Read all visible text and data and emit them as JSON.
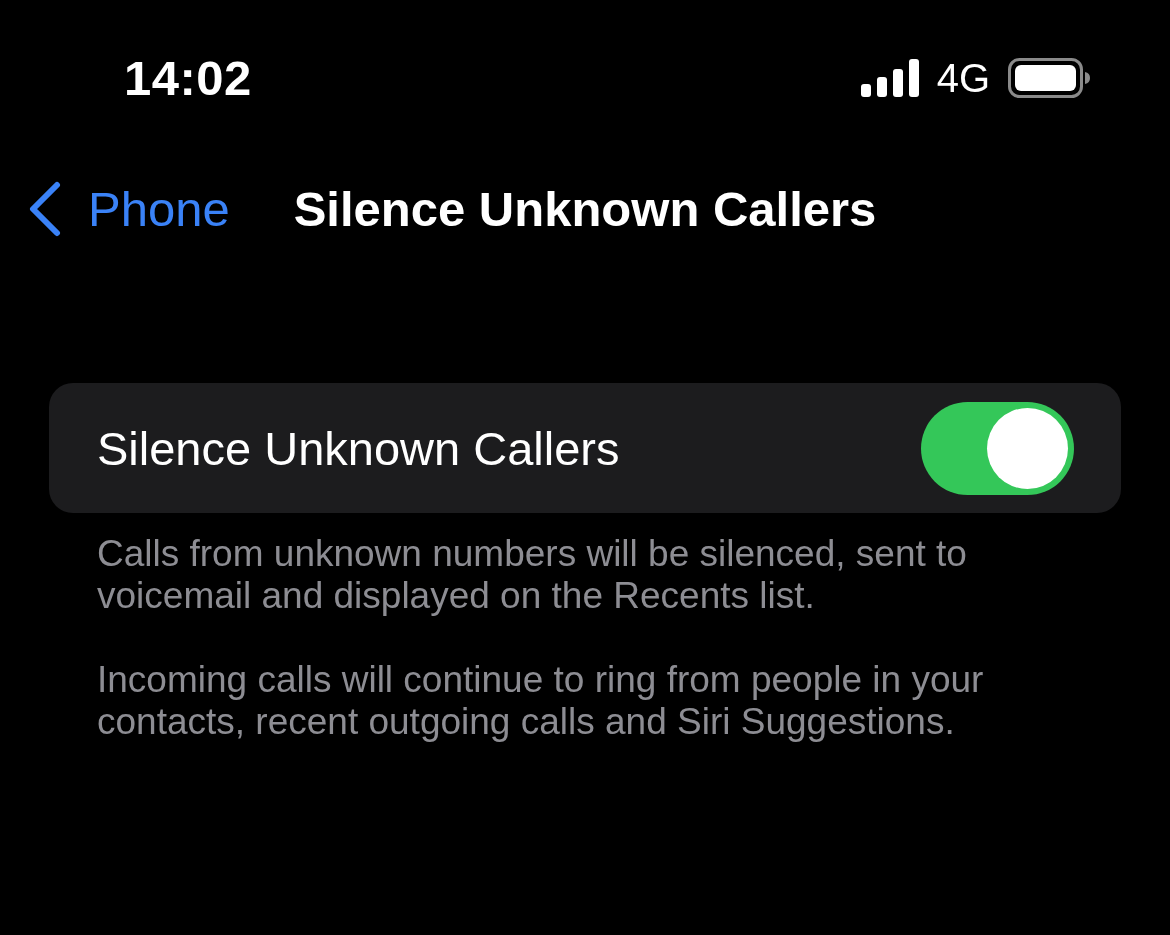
{
  "status_bar": {
    "time": "14:02",
    "network": "4G"
  },
  "nav_bar": {
    "back_label": "Phone",
    "title": "Silence Unknown Callers"
  },
  "settings": [
    {
      "kind": "toggle",
      "label": "Silence Unknown Callers",
      "on": true
    }
  ],
  "footer_notes": [
    "Calls from unknown numbers will be silenced, sent to voicemail and displayed on the Recents list.",
    "Incoming calls will continue to ring from people in your contacts, recent outgoing calls and Siri Suggestions."
  ]
}
